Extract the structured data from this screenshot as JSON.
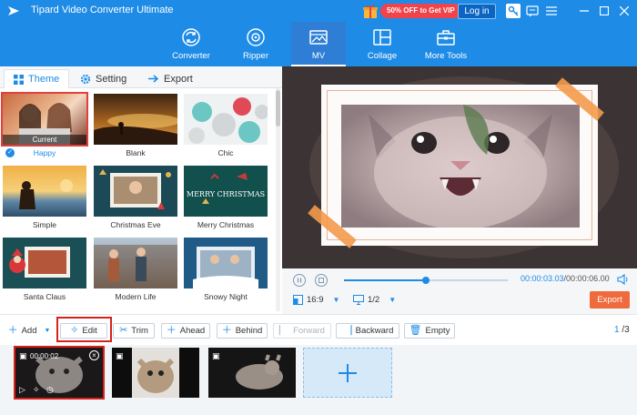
{
  "app": {
    "title": "Tipard Video Converter Ultimate",
    "promo": "50% OFF to Get VIP",
    "login": "Log in"
  },
  "nav": {
    "items": [
      {
        "label": "Converter",
        "icon": "converter-icon"
      },
      {
        "label": "Ripper",
        "icon": "ripper-icon"
      },
      {
        "label": "MV",
        "icon": "mv-icon"
      },
      {
        "label": "Collage",
        "icon": "collage-icon"
      },
      {
        "label": "More Tools",
        "icon": "toolbox-icon"
      }
    ],
    "active": "MV"
  },
  "tabs": {
    "theme": "Theme",
    "setting": "Setting",
    "export": "Export"
  },
  "themes": [
    {
      "name": "Happy",
      "badge": "Current",
      "selected": true
    },
    {
      "name": "Blank"
    },
    {
      "name": "Chic"
    },
    {
      "name": "Simple"
    },
    {
      "name": "Christmas Eve"
    },
    {
      "name": "Merry Christmas",
      "overlay": "MERRY CHRISTMAS"
    },
    {
      "name": "Santa Claus"
    },
    {
      "name": "Modern Life"
    },
    {
      "name": "Snowy Night"
    }
  ],
  "player": {
    "current_time": "00:00:03.03",
    "total_time": "/00:00:06.00",
    "progress_fraction": 0.5,
    "aspect_ratio": "16:9",
    "screen_ratio": "1/2",
    "export_label": "Export"
  },
  "toolbar": {
    "add": "Add",
    "edit": "Edit",
    "trim": "Trim",
    "ahead": "Ahead",
    "behind": "Behind",
    "forward": "Forward",
    "backward": "Backward",
    "empty": "Empty",
    "page": "1",
    "page_total": "/3"
  },
  "timeline": {
    "clips": [
      {
        "time": "00:00:02",
        "selected": true
      },
      {
        "time": ""
      },
      {
        "time": ""
      }
    ]
  }
}
